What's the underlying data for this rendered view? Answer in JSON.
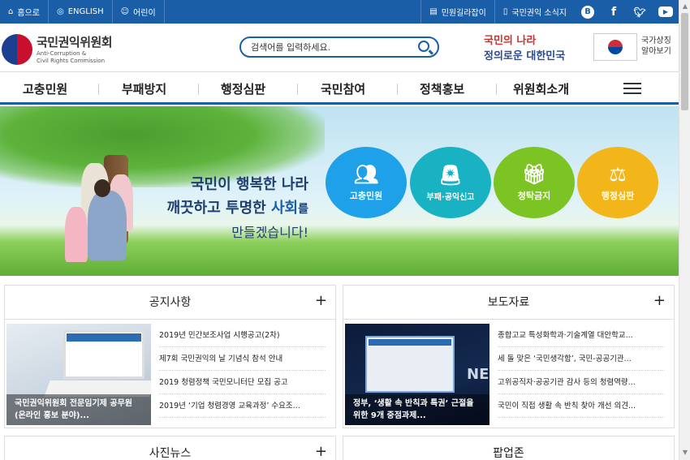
{
  "topbar": {
    "left": [
      {
        "label": "홈으로",
        "icon": "home-icon"
      },
      {
        "label": "ENGLISH",
        "icon": "globe-icon"
      },
      {
        "label": "어린이",
        "icon": "person-icon"
      }
    ],
    "right": [
      {
        "label": "민원길라잡이",
        "icon": "document-icon"
      },
      {
        "label": "국민권익 소식지",
        "icon": "book-icon"
      }
    ],
    "social": [
      "blog-icon",
      "facebook-icon",
      "twitter-icon",
      "youtube-icon"
    ]
  },
  "header": {
    "logo_ko": "국민권익위원회",
    "logo_en_1": "Anti-Corruption &",
    "logo_en_2": "Civil Rights Commission",
    "search_placeholder": "검색어를 입력하세요.",
    "slogan_1": "국민의 나라",
    "slogan_2": "정의로운 대한민국",
    "flag_label_1": "국가상징",
    "flag_label_2": "알아보기"
  },
  "gnb": [
    "고충민원",
    "부패방지",
    "행정심판",
    "국민참여",
    "정책홍보",
    "위원회소개"
  ],
  "banner": {
    "line1": "국민이 행복한 나라",
    "line2a": "깨끗하고 투명한 ",
    "line2b": "사회",
    "line2c": "를",
    "line3": "만들겠습니다!",
    "circles": [
      {
        "label": "고충민원",
        "color": "#1ea1e8",
        "icon": "people-chat-icon"
      },
      {
        "label": "부패·공익신고",
        "color": "#18b2c2",
        "icon": "siren-icon"
      },
      {
        "label": "청탁금지",
        "color": "#7cc424",
        "icon": "gift-block-icon"
      },
      {
        "label": "행정심판",
        "color": "#f2b61a",
        "icon": "gavel-icon"
      }
    ]
  },
  "notice": {
    "title": "공지사항",
    "caption": "국민권익위원회 전문임기제 공무원(온라인 홍보 분야)...",
    "items": [
      "2019년 민간보조사업 시행공고(2차)",
      "제7회 국민권익의 날 기념식 참석 안내",
      "2019 청렴정책 국민모니터단 모집 공고",
      "2019년 ‘기업 청렴경영 교육과정’ 수요조..."
    ]
  },
  "press": {
    "title": "보도자료",
    "caption": "정부, ‘생활 속 반칙과 특권’ 근절을 위한 9개 중점과제...",
    "items": [
      "종합고교 특성화학과·기술계열 대안학교...",
      "세 돌 맞은 ‘국민생각함’, 국민-공공기관...",
      "고위공직자·공공기관 감사 등의 청렴역량...",
      "국민이 직접 생활 속 반칙 찾아 개선 의견..."
    ]
  },
  "photo": {
    "title": "사진뉴스"
  },
  "popup": {
    "title": "팝업존"
  }
}
